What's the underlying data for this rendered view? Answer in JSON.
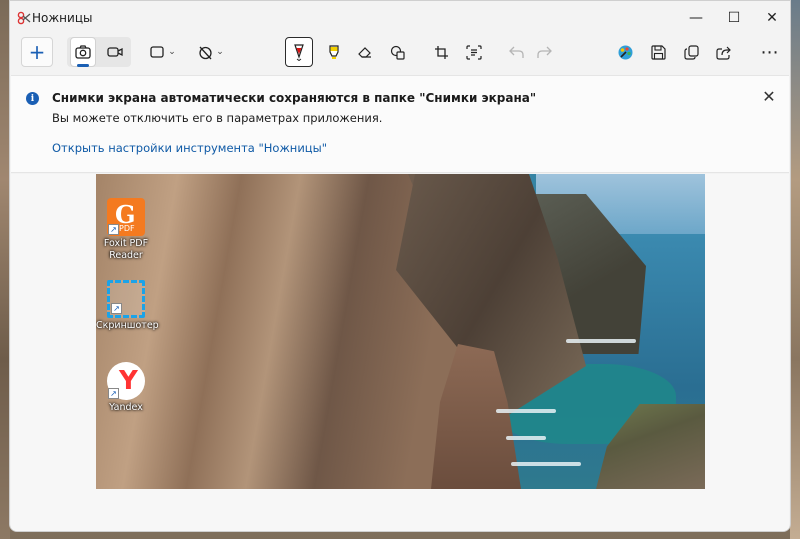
{
  "window": {
    "title": "Ножницы"
  },
  "titlebar": {
    "minimize": "—",
    "maximize": "☐",
    "close": "✕"
  },
  "toolbar": {
    "new": "+",
    "more": "⋯",
    "icons": {
      "new": "plus-icon",
      "screenshot_mode": "camera-icon",
      "video_mode": "video-camera-icon",
      "snip_shape": "rectangle-snip-icon",
      "delay": "timer-off-icon",
      "pen": "ballpoint-pen-icon",
      "highlighter": "highlighter-icon",
      "eraser": "eraser-icon",
      "shapes": "shapes-icon",
      "crop": "crop-icon",
      "text_actions": "text-actions-icon",
      "undo": "undo-icon",
      "redo": "redo-icon",
      "edit_paint": "paint-icon",
      "save": "save-icon",
      "copy": "copy-icon",
      "share": "share-icon"
    }
  },
  "banner": {
    "title": "Снимки экрана автоматически сохраняются в папке \"Снимки экрана\"",
    "message": "Вы можете отключить его в параметрах приложения.",
    "link": "Открыть настройки инструмента \"Ножницы\"",
    "close": "✕"
  },
  "desktop_icons": [
    {
      "label": "Foxit PDF Reader",
      "icon": "foxit-pdf-reader-icon"
    },
    {
      "label": "Скриншотер",
      "icon": "screenshoter-icon"
    },
    {
      "label": "Yandex",
      "icon": "yandex-browser-icon"
    }
  ],
  "colors": {
    "accent": "#1a5fb4",
    "link": "#0f5aa6",
    "foxit": "#f47a20",
    "screenshoter": "#1ba3e8",
    "yandex": "#ff3333"
  }
}
